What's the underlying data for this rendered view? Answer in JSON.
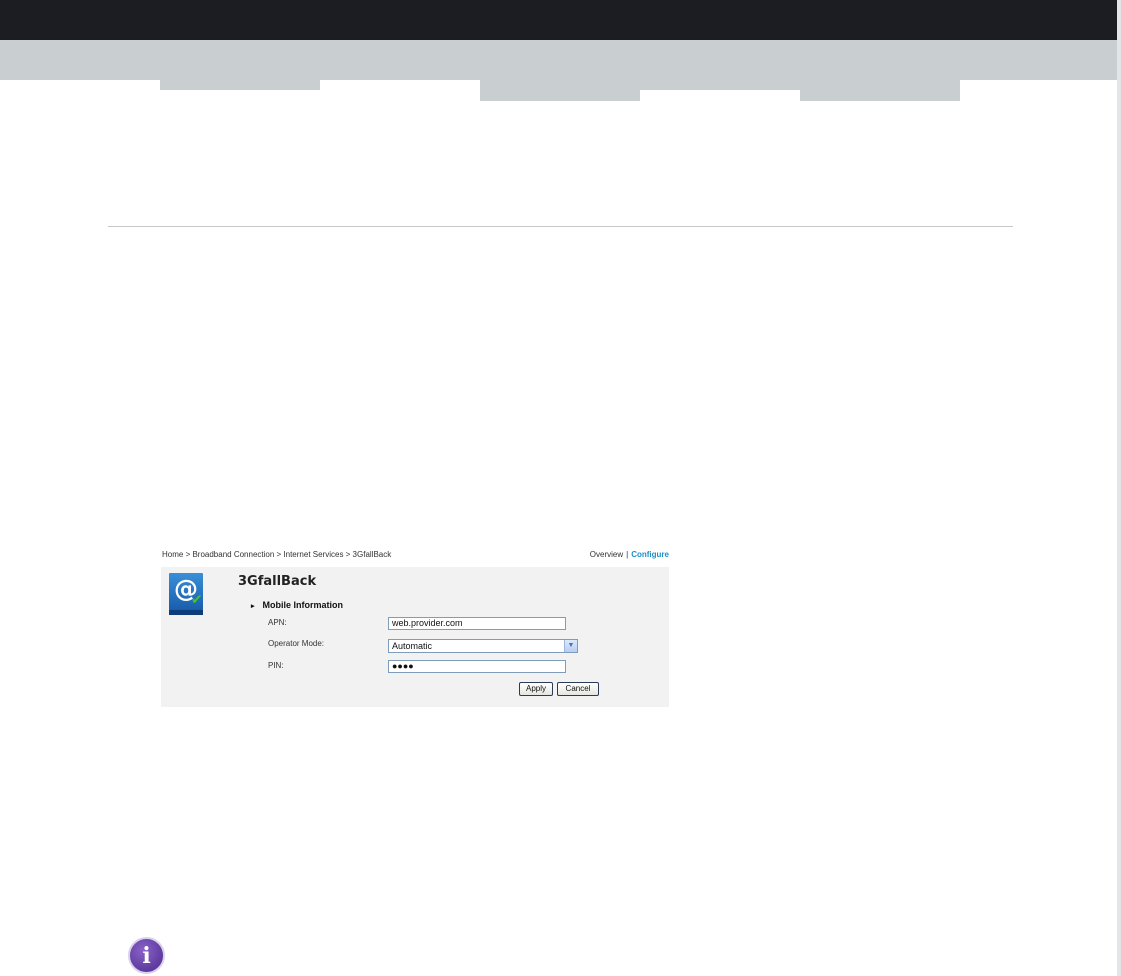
{
  "breadcrumb": "Home > Broadband Connection > Internet Services > 3GfallBack",
  "view_links": {
    "overview": "Overview",
    "separator": "|",
    "configure": "Configure"
  },
  "section_title": "3GfallBack",
  "subsection": {
    "arrow": "▸",
    "title": "Mobile Information"
  },
  "form": {
    "apn_label": "APN:",
    "apn_value": "web.provider.com",
    "operator_label": "Operator Mode:",
    "operator_value": "Automatic",
    "pin_label": "PIN:",
    "pin_value": "●●●●"
  },
  "buttons": {
    "apply": "Apply",
    "cancel": "Cancel"
  },
  "icons": {
    "app_icon": "at-sign-check-icon",
    "info_icon": "info-icon",
    "dropdown": "chevron-down-icon"
  },
  "colors": {
    "topbar": "#1b1d22",
    "band": "#c9cfd1",
    "link_active": "#1a8fc8",
    "info": "#5a3a9c"
  }
}
